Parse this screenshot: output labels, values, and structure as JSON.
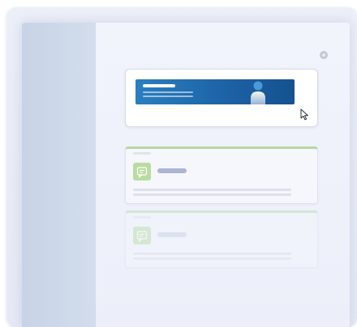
{
  "app": {
    "type": "modal-illustration"
  },
  "modal": {
    "close_icon": "close-icon"
  },
  "promo": {
    "banner_colors": [
      "#2a7fc0",
      "#15518f"
    ],
    "person_icon": "person-icon",
    "cursor_icon": "cursor-pointer-icon"
  },
  "cards": [
    {
      "icon": "chat-icon",
      "accent": "#b8d8a2",
      "state": "active"
    },
    {
      "icon": "chat-icon",
      "accent": "#b8d8a2",
      "state": "faded"
    }
  ],
  "colors": {
    "sidebar": "#c7d4e6",
    "content_bg": "#eef1fa",
    "card_accent": "#b8d8a2",
    "banner": "#1d63a7"
  }
}
